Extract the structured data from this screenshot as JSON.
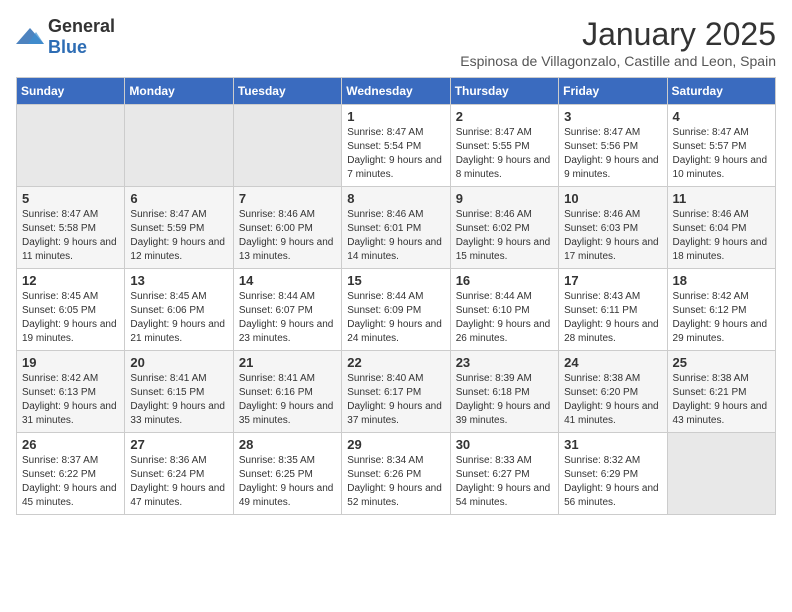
{
  "logo": {
    "general": "General",
    "blue": "Blue"
  },
  "title": "January 2025",
  "subtitle": "Espinosa de Villagonzalo, Castille and Leon, Spain",
  "weekdays": [
    "Sunday",
    "Monday",
    "Tuesday",
    "Wednesday",
    "Thursday",
    "Friday",
    "Saturday"
  ],
  "weeks": [
    [
      {
        "day": "",
        "sunrise": "",
        "sunset": "",
        "daylight": ""
      },
      {
        "day": "",
        "sunrise": "",
        "sunset": "",
        "daylight": ""
      },
      {
        "day": "",
        "sunrise": "",
        "sunset": "",
        "daylight": ""
      },
      {
        "day": "1",
        "sunrise": "Sunrise: 8:47 AM",
        "sunset": "Sunset: 5:54 PM",
        "daylight": "Daylight: 9 hours and 7 minutes."
      },
      {
        "day": "2",
        "sunrise": "Sunrise: 8:47 AM",
        "sunset": "Sunset: 5:55 PM",
        "daylight": "Daylight: 9 hours and 8 minutes."
      },
      {
        "day": "3",
        "sunrise": "Sunrise: 8:47 AM",
        "sunset": "Sunset: 5:56 PM",
        "daylight": "Daylight: 9 hours and 9 minutes."
      },
      {
        "day": "4",
        "sunrise": "Sunrise: 8:47 AM",
        "sunset": "Sunset: 5:57 PM",
        "daylight": "Daylight: 9 hours and 10 minutes."
      }
    ],
    [
      {
        "day": "5",
        "sunrise": "Sunrise: 8:47 AM",
        "sunset": "Sunset: 5:58 PM",
        "daylight": "Daylight: 9 hours and 11 minutes."
      },
      {
        "day": "6",
        "sunrise": "Sunrise: 8:47 AM",
        "sunset": "Sunset: 5:59 PM",
        "daylight": "Daylight: 9 hours and 12 minutes."
      },
      {
        "day": "7",
        "sunrise": "Sunrise: 8:46 AM",
        "sunset": "Sunset: 6:00 PM",
        "daylight": "Daylight: 9 hours and 13 minutes."
      },
      {
        "day": "8",
        "sunrise": "Sunrise: 8:46 AM",
        "sunset": "Sunset: 6:01 PM",
        "daylight": "Daylight: 9 hours and 14 minutes."
      },
      {
        "day": "9",
        "sunrise": "Sunrise: 8:46 AM",
        "sunset": "Sunset: 6:02 PM",
        "daylight": "Daylight: 9 hours and 15 minutes."
      },
      {
        "day": "10",
        "sunrise": "Sunrise: 8:46 AM",
        "sunset": "Sunset: 6:03 PM",
        "daylight": "Daylight: 9 hours and 17 minutes."
      },
      {
        "day": "11",
        "sunrise": "Sunrise: 8:46 AM",
        "sunset": "Sunset: 6:04 PM",
        "daylight": "Daylight: 9 hours and 18 minutes."
      }
    ],
    [
      {
        "day": "12",
        "sunrise": "Sunrise: 8:45 AM",
        "sunset": "Sunset: 6:05 PM",
        "daylight": "Daylight: 9 hours and 19 minutes."
      },
      {
        "day": "13",
        "sunrise": "Sunrise: 8:45 AM",
        "sunset": "Sunset: 6:06 PM",
        "daylight": "Daylight: 9 hours and 21 minutes."
      },
      {
        "day": "14",
        "sunrise": "Sunrise: 8:44 AM",
        "sunset": "Sunset: 6:07 PM",
        "daylight": "Daylight: 9 hours and 23 minutes."
      },
      {
        "day": "15",
        "sunrise": "Sunrise: 8:44 AM",
        "sunset": "Sunset: 6:09 PM",
        "daylight": "Daylight: 9 hours and 24 minutes."
      },
      {
        "day": "16",
        "sunrise": "Sunrise: 8:44 AM",
        "sunset": "Sunset: 6:10 PM",
        "daylight": "Daylight: 9 hours and 26 minutes."
      },
      {
        "day": "17",
        "sunrise": "Sunrise: 8:43 AM",
        "sunset": "Sunset: 6:11 PM",
        "daylight": "Daylight: 9 hours and 28 minutes."
      },
      {
        "day": "18",
        "sunrise": "Sunrise: 8:42 AM",
        "sunset": "Sunset: 6:12 PM",
        "daylight": "Daylight: 9 hours and 29 minutes."
      }
    ],
    [
      {
        "day": "19",
        "sunrise": "Sunrise: 8:42 AM",
        "sunset": "Sunset: 6:13 PM",
        "daylight": "Daylight: 9 hours and 31 minutes."
      },
      {
        "day": "20",
        "sunrise": "Sunrise: 8:41 AM",
        "sunset": "Sunset: 6:15 PM",
        "daylight": "Daylight: 9 hours and 33 minutes."
      },
      {
        "day": "21",
        "sunrise": "Sunrise: 8:41 AM",
        "sunset": "Sunset: 6:16 PM",
        "daylight": "Daylight: 9 hours and 35 minutes."
      },
      {
        "day": "22",
        "sunrise": "Sunrise: 8:40 AM",
        "sunset": "Sunset: 6:17 PM",
        "daylight": "Daylight: 9 hours and 37 minutes."
      },
      {
        "day": "23",
        "sunrise": "Sunrise: 8:39 AM",
        "sunset": "Sunset: 6:18 PM",
        "daylight": "Daylight: 9 hours and 39 minutes."
      },
      {
        "day": "24",
        "sunrise": "Sunrise: 8:38 AM",
        "sunset": "Sunset: 6:20 PM",
        "daylight": "Daylight: 9 hours and 41 minutes."
      },
      {
        "day": "25",
        "sunrise": "Sunrise: 8:38 AM",
        "sunset": "Sunset: 6:21 PM",
        "daylight": "Daylight: 9 hours and 43 minutes."
      }
    ],
    [
      {
        "day": "26",
        "sunrise": "Sunrise: 8:37 AM",
        "sunset": "Sunset: 6:22 PM",
        "daylight": "Daylight: 9 hours and 45 minutes."
      },
      {
        "day": "27",
        "sunrise": "Sunrise: 8:36 AM",
        "sunset": "Sunset: 6:24 PM",
        "daylight": "Daylight: 9 hours and 47 minutes."
      },
      {
        "day": "28",
        "sunrise": "Sunrise: 8:35 AM",
        "sunset": "Sunset: 6:25 PM",
        "daylight": "Daylight: 9 hours and 49 minutes."
      },
      {
        "day": "29",
        "sunrise": "Sunrise: 8:34 AM",
        "sunset": "Sunset: 6:26 PM",
        "daylight": "Daylight: 9 hours and 52 minutes."
      },
      {
        "day": "30",
        "sunrise": "Sunrise: 8:33 AM",
        "sunset": "Sunset: 6:27 PM",
        "daylight": "Daylight: 9 hours and 54 minutes."
      },
      {
        "day": "31",
        "sunrise": "Sunrise: 8:32 AM",
        "sunset": "Sunset: 6:29 PM",
        "daylight": "Daylight: 9 hours and 56 minutes."
      },
      {
        "day": "",
        "sunrise": "",
        "sunset": "",
        "daylight": ""
      }
    ]
  ]
}
